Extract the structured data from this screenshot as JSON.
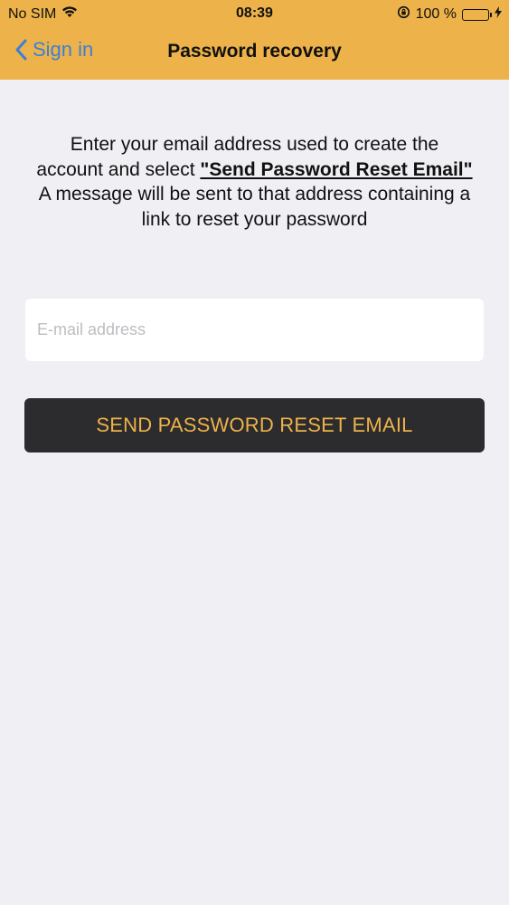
{
  "status_bar": {
    "carrier": "No SIM",
    "time": "08:39",
    "battery_percent": "100 %"
  },
  "nav": {
    "back_label": "Sign in",
    "title": "Password recovery"
  },
  "instructions": {
    "line1_prefix": "Enter your email address used to create the account and select ",
    "emphasis": "\"Send Password Reset Email\"",
    "line2": "A message will be sent to that address containing a link to reset your password"
  },
  "form": {
    "email_placeholder": "E-mail address",
    "email_value": "",
    "send_button_label": "SEND PASSWORD RESET EMAIL"
  },
  "colors": {
    "header_bg": "#edb249",
    "accent_blue": "#3b80d6",
    "button_bg": "#2c2c2e",
    "button_text": "#edb249",
    "page_bg": "#efeff4"
  }
}
